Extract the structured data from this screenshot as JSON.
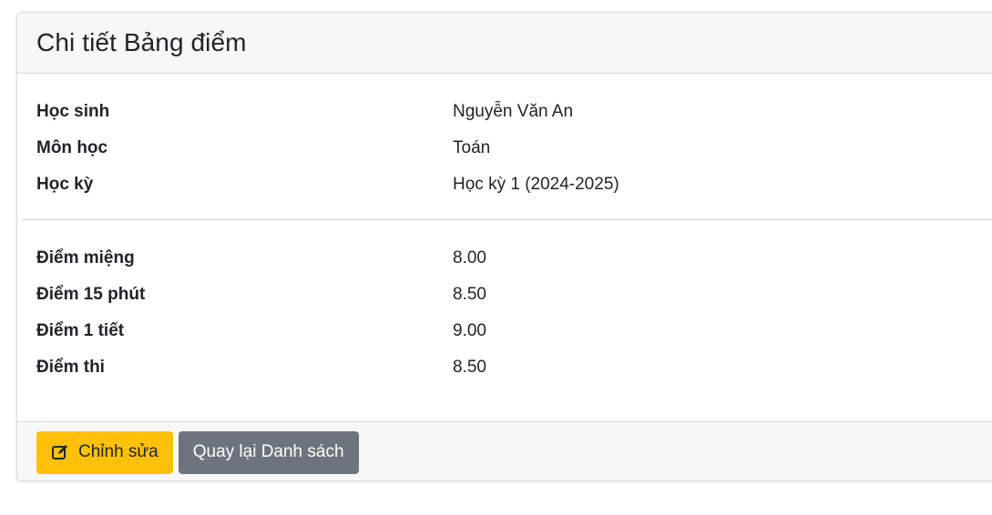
{
  "card": {
    "title": "Chi tiết Bảng điểm"
  },
  "info": [
    {
      "label": "Học sinh",
      "value": "Nguyễn Văn An"
    },
    {
      "label": "Môn học",
      "value": "Toán"
    },
    {
      "label": "Học kỳ",
      "value": "Học kỳ 1 (2024-2025)"
    }
  ],
  "scores": [
    {
      "label": "Điểm miệng",
      "value": "8.00"
    },
    {
      "label": "Điểm 15 phút",
      "value": "8.50"
    },
    {
      "label": "Điểm 1 tiết",
      "value": "9.00"
    },
    {
      "label": "Điểm thi",
      "value": "8.50"
    }
  ],
  "actions": {
    "edit_label": "Chỉnh sửa",
    "edit_icon": "edit-icon",
    "back_label": "Quay lại Danh sách"
  },
  "colors": {
    "edit_button": "#ffc107",
    "back_button": "#6c757d",
    "header_background": "#f7f7f7"
  }
}
